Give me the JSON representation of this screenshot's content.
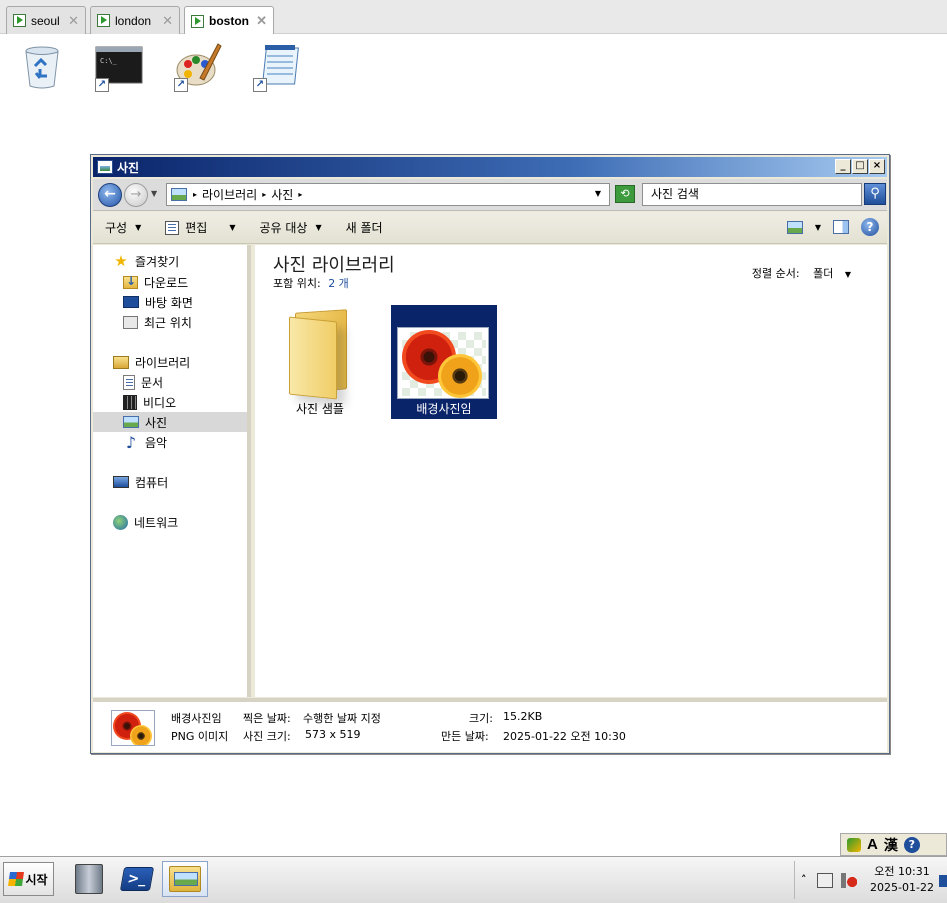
{
  "tabs": [
    {
      "label": "seoul",
      "active": false
    },
    {
      "label": "london",
      "active": false
    },
    {
      "label": "boston",
      "active": true
    }
  ],
  "desktop": {
    "icons": [
      "recycle-bin-icon",
      "command-prompt-icon",
      "paint-icon",
      "notepad-icon"
    ]
  },
  "window": {
    "title": "사진",
    "buttons": {
      "minimize": "_",
      "maximize": "□",
      "close": "×"
    },
    "address": {
      "crumbs": [
        "라이브러리",
        "사진"
      ],
      "search_placeholder": "사진 검색"
    },
    "toolbar": {
      "organize": "구성",
      "edit": "편집",
      "share": "공유 대상",
      "new_folder": "새 폴더"
    },
    "nav": {
      "favorites": "즐겨찾기",
      "downloads": "다운로드",
      "desktop": "바탕 화면",
      "recent": "최근 위치",
      "libraries": "라이브러리",
      "documents": "문서",
      "videos": "비디오",
      "pictures": "사진",
      "music": "음악",
      "computer": "컴퓨터",
      "network": "네트워크"
    },
    "content": {
      "title": "사진 라이브러리",
      "includes_label": "포함 위치:",
      "includes_count": "2 개",
      "sort_label": "정렬 순서:",
      "sort_value": "폴더",
      "items": [
        {
          "label": "사진 샘플",
          "type": "folder",
          "selected": false
        },
        {
          "label": "배경사진임",
          "type": "image",
          "selected": true
        }
      ]
    },
    "details": {
      "name": "배경사진임",
      "type": "PNG 이미지",
      "date_taken_label": "찍은 날짜:",
      "date_taken_value": "수행한 날짜 지정",
      "dimensions_label": "사진 크기:",
      "dimensions_value": "573 x 519",
      "size_label": "크기:",
      "size_value": "15.2KB",
      "created_label": "만든 날짜:",
      "created_value": "2025-01-22 오전 10:30"
    }
  },
  "langbar": {
    "mode": "A",
    "hanja": "漢",
    "help": "?"
  },
  "taskbar": {
    "start_label": "시작",
    "clock_time": "오전 10:31",
    "clock_date": "2025-01-22"
  },
  "colors": {
    "title_gradient_start": "#0a246a",
    "selection": "#0a246a",
    "nav_selected": "#d8d8d8"
  }
}
